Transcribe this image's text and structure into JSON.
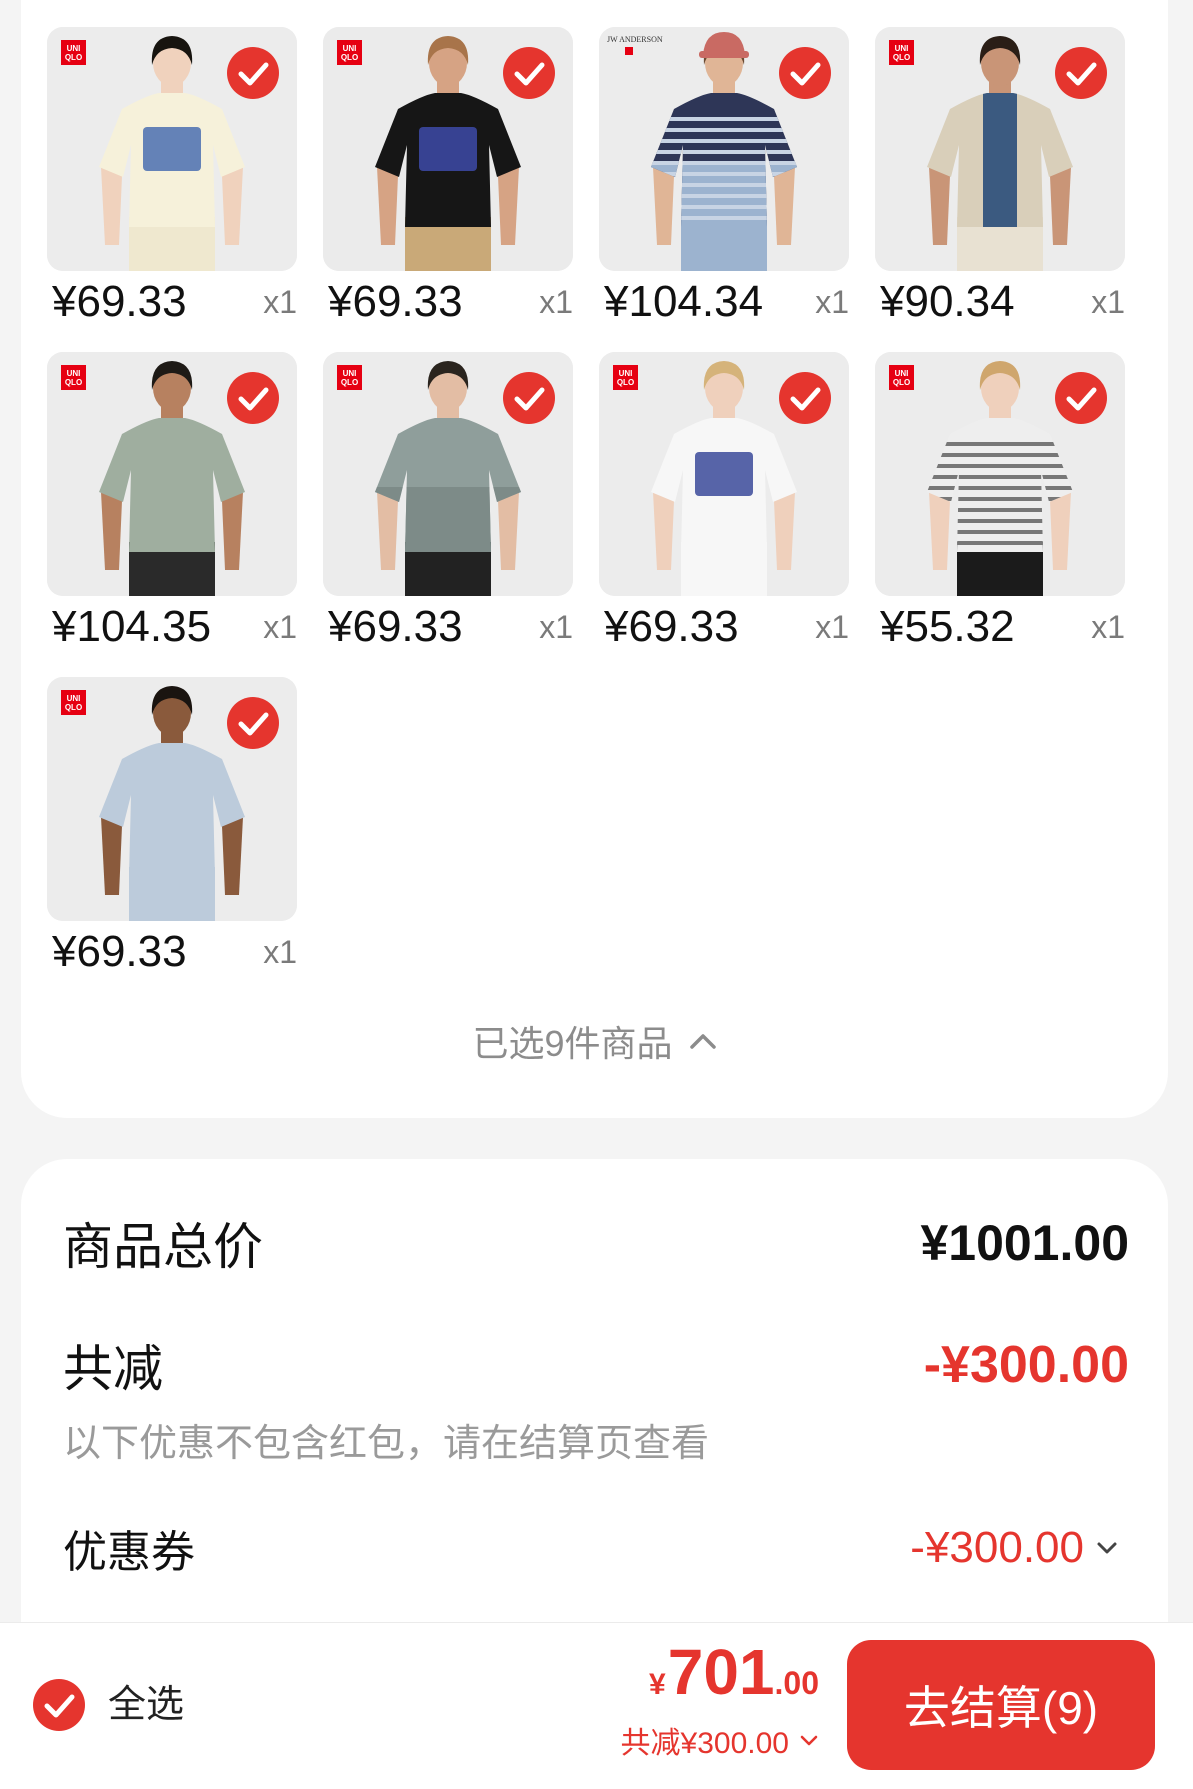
{
  "colors": {
    "accent": "#e5352e",
    "page_bg": "#f4f4f4",
    "logo_red": "#e60012",
    "muted_text": "#8c8c8c"
  },
  "products": [
    {
      "price": "¥69.33",
      "qty": "x1",
      "checked": true,
      "logo": {
        "icon": "uniqlo-logo-icon",
        "lines": [
          "UNI",
          "QLO"
        ]
      },
      "photo": {
        "bg": "#ececec",
        "skin": "#f0d2bd",
        "hair": "#17140f",
        "shirt": "#f6f1da",
        "pants": "#efe8cf",
        "print": "#4a6fb0"
      }
    },
    {
      "price": "¥69.33",
      "qty": "x1",
      "checked": true,
      "logo": {
        "icon": "uniqlo-logo-icon",
        "lines": [
          "UNI",
          "QLO"
        ]
      },
      "photo": {
        "bg": "#ebebeb",
        "skin": "#d6a384",
        "hair": "#a8744a",
        "shirt": "#161616",
        "pants": "#c9a978",
        "print": "#3d4aa8"
      }
    },
    {
      "price": "¥104.34",
      "qty": "x1",
      "checked": true,
      "logo": {
        "icon": "jw-anderson-logo-icon",
        "lines": [
          "JW ANDERSON"
        ]
      },
      "photo": {
        "bg": "#ececec",
        "skin": "#e0b596",
        "hair": "#6b4a32",
        "cap": "#c96a63",
        "shirt": "#2e3657",
        "shirt2": "#9cb3cf",
        "stripe": "#c8d4e4",
        "pants": "#9cb3cf"
      }
    },
    {
      "price": "¥90.34",
      "qty": "x1",
      "checked": true,
      "logo": {
        "icon": "uniqlo-logo-icon",
        "lines": [
          "UNI",
          "QLO"
        ]
      },
      "photo": {
        "bg": "#ececec",
        "skin": "#c99577",
        "hair": "#2a1e16",
        "shirt": "#3b5a80",
        "jacket": "#d9cfba",
        "pants": "#e8e1d2"
      }
    },
    {
      "price": "¥104.35",
      "qty": "x1",
      "checked": true,
      "logo": {
        "icon": "uniqlo-logo-icon",
        "lines": [
          "UNI",
          "QLO"
        ]
      },
      "photo": {
        "bg": "#ececec",
        "skin": "#b78160",
        "hair": "#1e1a16",
        "shirt": "#9fae9f",
        "pants": "#2a2a2a"
      }
    },
    {
      "price": "¥69.33",
      "qty": "x1",
      "checked": true,
      "logo": {
        "icon": "uniqlo-logo-icon",
        "lines": [
          "UNI",
          "QLO"
        ]
      },
      "photo": {
        "bg": "#ececec",
        "skin": "#e3bda4",
        "hair": "#2a241e",
        "shirt": "#8f9e9b",
        "shirt2": "#7d8b88",
        "pants": "#222222"
      }
    },
    {
      "price": "¥69.33",
      "qty": "x1",
      "checked": true,
      "logo": {
        "icon": "uniqlo-logo-icon",
        "lines": [
          "UNI",
          "QLO"
        ]
      },
      "photo": {
        "bg": "#ececec",
        "skin": "#efd0bc",
        "hair": "#d5b37a",
        "shirt": "#f7f7f7",
        "pants": "#f7f7f7",
        "print": "#3b4a9a"
      }
    },
    {
      "price": "¥55.32",
      "qty": "x1",
      "checked": true,
      "logo": {
        "icon": "uniqlo-logo-icon",
        "lines": [
          "UNI",
          "QLO"
        ]
      },
      "photo": {
        "bg": "#ececec",
        "skin": "#efd0bc",
        "hair": "#cfa66d",
        "shirt": "#eeeeee",
        "stripe": "#777777",
        "pants": "#1b1b1b"
      }
    },
    {
      "price": "¥69.33",
      "qty": "x1",
      "checked": true,
      "logo": {
        "icon": "uniqlo-logo-icon",
        "lines": [
          "UNI",
          "QLO"
        ]
      },
      "photo": {
        "bg": "#ececec",
        "skin": "#8a5a3c",
        "hair": "#1a1410",
        "shirt": "#bccbdb",
        "pants": "#bccbdb"
      }
    }
  ],
  "selection": {
    "label": "已选9件商品",
    "toggle_icon": "chevron-up-icon"
  },
  "summary": {
    "subtotal_label": "商品总价",
    "subtotal_value": "¥1001.00",
    "discount_label": "共减",
    "discount_value": "-¥300.00",
    "discount_note": "以下优惠不包含红包，请在结算页查看",
    "coupon_label": "优惠券",
    "coupon_value": "-¥300.00",
    "coupon_icon": "chevron-down-icon"
  },
  "footer": {
    "select_all_label": "全选",
    "select_all_checked": true,
    "total_currency": "¥",
    "total_integer": "701",
    "total_decimal": ".00",
    "total_discount": "共减¥300.00",
    "checkout_label": "去结算(9)"
  }
}
